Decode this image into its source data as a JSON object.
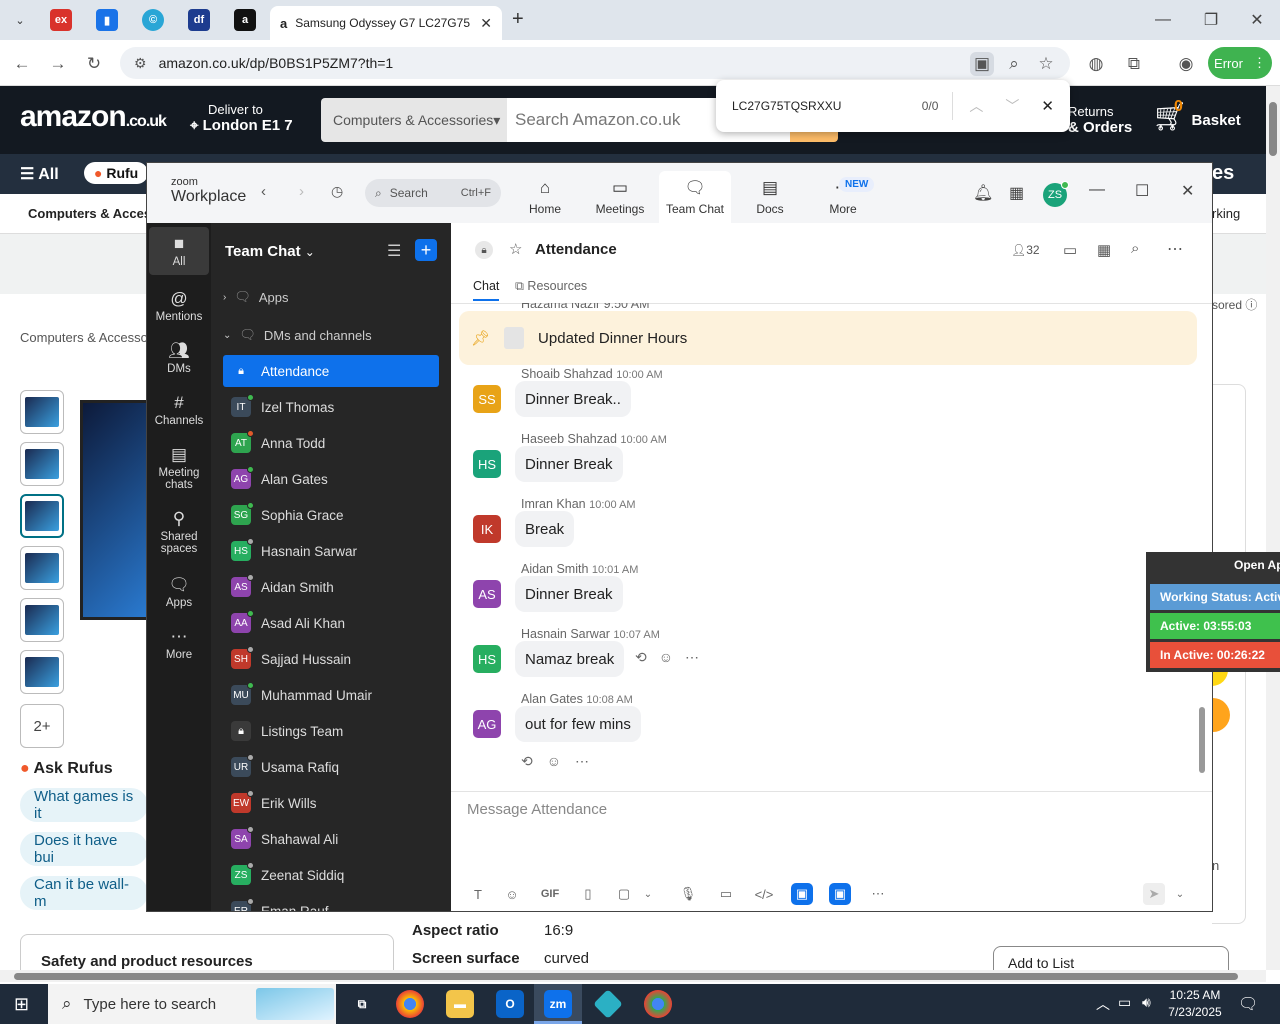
{
  "browser": {
    "active_tab_title": "Samsung Odyssey G7 LC27G75",
    "url": "amazon.co.uk/dp/B0BS1P5ZM7?th=1",
    "profile_button": "Error"
  },
  "find_bar": {
    "query": "LC27G75TQSRXXU",
    "count": "0/0"
  },
  "amazon": {
    "logo": "amazon",
    "logo_tld": ".co.uk",
    "deliver_to": "Deliver to",
    "location": "London E1 7",
    "search_category": "Computers & Accessories",
    "search_placeholder": "Search Amazon.co.uk",
    "returns_l1": "Returns",
    "returns_l2": "& Orders",
    "basket_count": "0",
    "basket": "Basket",
    "all_menu": "All",
    "rufus": "Rufu",
    "sub_nav": "Computers & Acces",
    "right_sub": "rking",
    "right_nav_fragment": "es",
    "breadcrumb": "Computers & Accesso",
    "sponsored": "sored",
    "thumb_more": "2+",
    "ask_rufus": "Ask Rufus",
    "suggestions": [
      "What games is it",
      "Does it have bui",
      "Can it be wall-m"
    ],
    "safety_title": "Safety and product resources",
    "specs": [
      {
        "key": "Aspect ratio",
        "value": "16:9"
      },
      {
        "key": "Screen surface",
        "value": "curved"
      }
    ],
    "add_to_list": "Add to List",
    "side_fragment": "n"
  },
  "status_widget": {
    "open_app": "Open Ap",
    "working": "Working Status: Activ",
    "active": "Active: 03:55:03",
    "inactive": "In Active: 00:26:22"
  },
  "zoom": {
    "brand_top": "zoom",
    "brand": "Workplace",
    "search": "Search",
    "search_shortcut": "Ctrl+F",
    "tabs": [
      {
        "label": "Home",
        "icon": "home-icon"
      },
      {
        "label": "Meetings",
        "icon": "video-camera-icon"
      },
      {
        "label": "Team Chat",
        "icon": "chat-bubbles-icon"
      },
      {
        "label": "Docs",
        "icon": "document-icon"
      },
      {
        "label": "More",
        "icon": "more-dots-icon"
      }
    ],
    "new_badge": "NEW",
    "user_initials": "ZS",
    "rail": [
      {
        "label": "All"
      },
      {
        "label": "Mentions"
      },
      {
        "label": "DMs"
      },
      {
        "label": "Channels"
      },
      {
        "label": "Meeting chats"
      },
      {
        "label": "Shared spaces"
      },
      {
        "label": "Apps"
      },
      {
        "label": "More"
      }
    ],
    "sidebar_title": "Team Chat",
    "apps_section": "Apps",
    "dms_section": "DMs and channels",
    "channels": [
      {
        "name": "Attendance",
        "initials": "",
        "color": "#0e71eb",
        "status": ""
      },
      {
        "name": "Izel Thomas",
        "initials": "IT",
        "color": "#3b4a5a",
        "status": "#3fb950"
      },
      {
        "name": "Anna Todd",
        "initials": "AT",
        "color": "#2ea44f",
        "status": "#e05a2b"
      },
      {
        "name": "Alan Gates",
        "initials": "AG",
        "color": "#8e44ad",
        "status": "#3fb950"
      },
      {
        "name": "Sophia Grace",
        "initials": "SG",
        "color": "#2ea44f",
        "status": "#3fb950"
      },
      {
        "name": "Hasnain Sarwar",
        "initials": "HS",
        "color": "#27ae60",
        "status": "#aaa"
      },
      {
        "name": "Aidan Smith",
        "initials": "AS",
        "color": "#8e44ad",
        "status": "#aaa"
      },
      {
        "name": "Asad Ali Khan",
        "initials": "AA",
        "color": "#8e44ad",
        "status": "#3fb950"
      },
      {
        "name": "Sajjad Hussain",
        "initials": "SH",
        "color": "#c0392b",
        "status": "#aaa"
      },
      {
        "name": "Muhammad Umair",
        "initials": "MU",
        "color": "#3b4a5a",
        "status": "#3fb950"
      },
      {
        "name": "Listings Team",
        "initials": "",
        "color": "#444",
        "status": ""
      },
      {
        "name": "Usama Rafiq",
        "initials": "UR",
        "color": "#3b4a5a",
        "status": "#aaa"
      },
      {
        "name": "Erik Wills",
        "initials": "EW",
        "color": "#c0392b",
        "status": "#aaa"
      },
      {
        "name": "Shahawal Ali",
        "initials": "SA",
        "color": "#8e44ad",
        "status": "#aaa"
      },
      {
        "name": "Zeenat Siddiq",
        "initials": "ZS",
        "color": "#27ae60",
        "status": "#aaa"
      },
      {
        "name": "Eman Rauf",
        "initials": "ER",
        "color": "#3b4a5a",
        "status": "#aaa"
      }
    ],
    "chat": {
      "title": "Attendance",
      "member_count": "32",
      "tab_chat": "Chat",
      "tab_resources": "Resources",
      "pinned_cut": "Hazama Nazir 9:50 AM",
      "pinned_text": "Updated Dinner Hours",
      "composer_placeholder": "Message Attendance",
      "gif": "GIF",
      "messages": [
        {
          "name": "Shoaib Shahzad",
          "time": "10:00 AM",
          "initials": "SS",
          "color": "#e8a317",
          "text": "Dinner Break.."
        },
        {
          "name": "Haseeb Shahzad",
          "time": "10:00 AM",
          "initials": "HS",
          "color": "#1aa37a",
          "text": "Dinner Break"
        },
        {
          "name": "Imran Khan",
          "time": "10:00 AM",
          "initials": "IK",
          "color": "#c0392b",
          "text": "Break"
        },
        {
          "name": "Aidan Smith",
          "time": "10:01 AM",
          "initials": "AS",
          "color": "#8e44ad",
          "text": "Dinner Break"
        },
        {
          "name": "Hasnain Sarwar",
          "time": "10:07 AM",
          "initials": "HS",
          "color": "#27ae60",
          "text": "Namaz break"
        },
        {
          "name": "Alan Gates",
          "time": "10:08 AM",
          "initials": "AG",
          "color": "#8e44ad",
          "text": "out for few mins"
        }
      ]
    }
  },
  "taskbar": {
    "search_placeholder": "Type here to search",
    "time": "10:25 AM",
    "date": "7/23/2025"
  }
}
